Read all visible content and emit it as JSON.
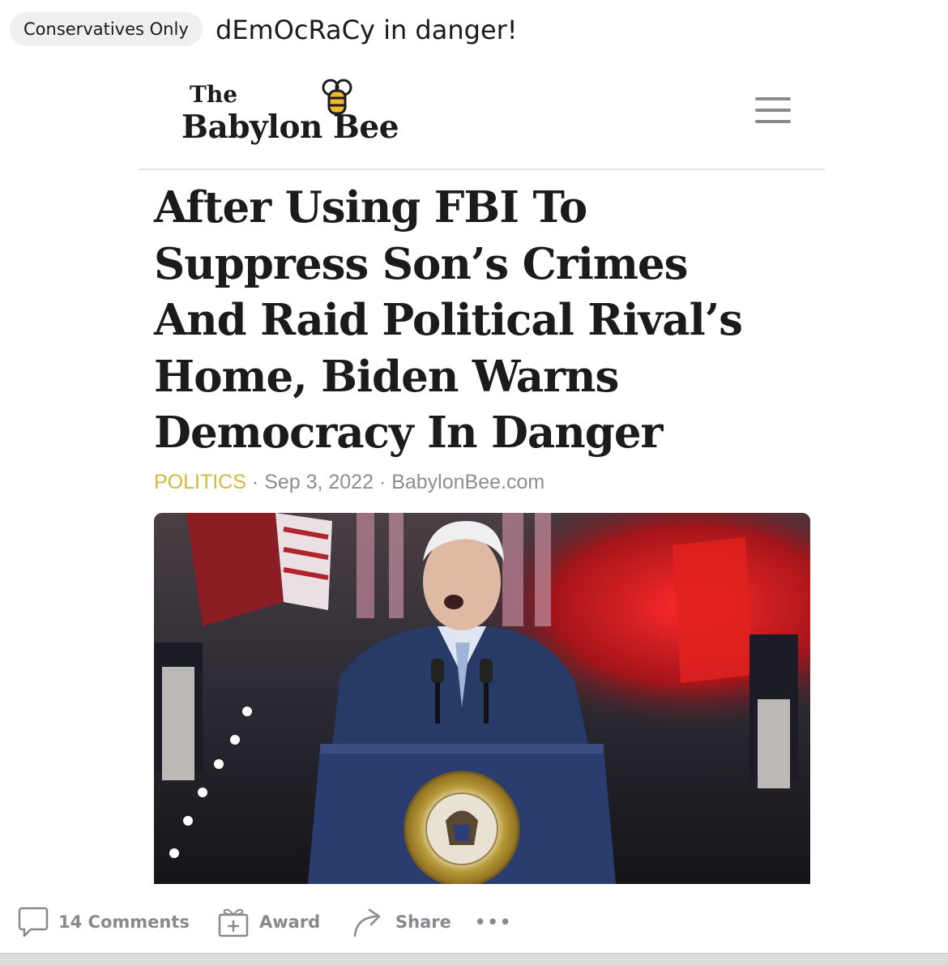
{
  "post": {
    "flair": "Conservatives Only",
    "title": "dEmOcRaCy in danger!"
  },
  "article": {
    "logo_the": "The",
    "logo_name": "Babylon Bee",
    "headline_lines": [
      "After Using FBI To",
      "Suppress Son’s Crimes",
      "And Raid Political Rival’s",
      "Home, Biden Warns",
      "Democracy In Danger"
    ],
    "category": "POLITICS",
    "separator": " · ",
    "date": "Sep 3, 2022",
    "source": "BabylonBee.com",
    "seal_text": "SEAL OF THE PRESIDENT OF THE UNITED STATES"
  },
  "actions": {
    "comments": "14 Comments",
    "award": "Award",
    "share": "Share",
    "more": "•••"
  },
  "icons": {
    "bee": "bee-logo-icon",
    "menu": "hamburger-menu-icon",
    "comment": "comment-bubble-icon",
    "award": "gift-box-icon",
    "share": "share-arrow-icon",
    "more": "more-options-icon"
  },
  "colors": {
    "category": "#d6b53d",
    "meta": "#8d8d8d",
    "action_text": "#878a8c",
    "flair_bg": "#edeff1"
  }
}
